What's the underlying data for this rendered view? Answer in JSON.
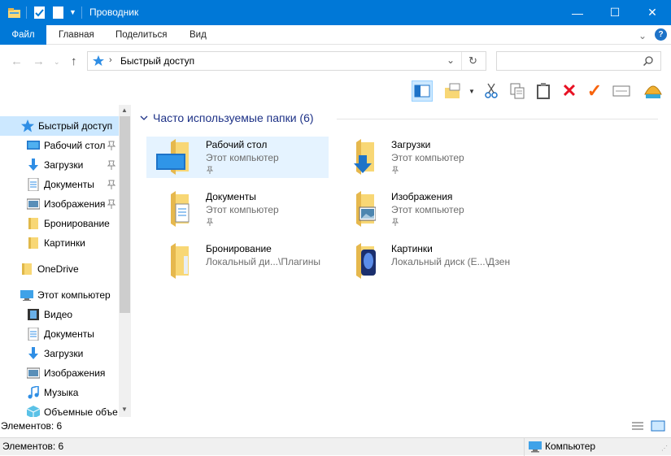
{
  "window": {
    "title": "Проводник",
    "minimize": "—",
    "maximize": "☐",
    "close": "✕"
  },
  "ribbon": {
    "tabs": [
      "Файл",
      "Главная",
      "Поделиться",
      "Вид"
    ],
    "help": "?",
    "expand": "⌄"
  },
  "address": {
    "path": "Быстрый доступ",
    "search_placeholder": ""
  },
  "nav": {
    "items": [
      {
        "label": "Быстрый доступ",
        "icon": "star-icon",
        "pinned": false,
        "selected": true
      },
      {
        "label": "Рабочий стол",
        "icon": "desktop-icon",
        "pinned": true
      },
      {
        "label": "Загрузки",
        "icon": "download-icon",
        "pinned": true
      },
      {
        "label": "Документы",
        "icon": "document-icon",
        "pinned": true
      },
      {
        "label": "Изображения",
        "icon": "pictures-icon",
        "pinned": true
      },
      {
        "label": "Бронирование",
        "icon": "folder-icon",
        "pinned": false
      },
      {
        "label": "Картинки",
        "icon": "folder-icon",
        "pinned": false
      },
      {
        "label": "OneDrive",
        "icon": "folder-icon",
        "pinned": false
      },
      {
        "label": "Этот компьютер",
        "icon": "computer-icon",
        "pinned": false
      },
      {
        "label": "Видео",
        "icon": "video-icon",
        "pinned": false
      },
      {
        "label": "Документы",
        "icon": "document-icon",
        "pinned": false
      },
      {
        "label": "Загрузки",
        "icon": "download-icon",
        "pinned": false
      },
      {
        "label": "Изображения",
        "icon": "pictures-icon",
        "pinned": false
      },
      {
        "label": "Музыка",
        "icon": "music-icon",
        "pinned": false
      },
      {
        "label": "Объемные объе",
        "icon": "3d-objects-icon",
        "pinned": false
      }
    ]
  },
  "content": {
    "group_title": "Часто используемые папки (6)",
    "tiles": [
      {
        "name": "Рабочий стол",
        "location": "Этот компьютер",
        "pinned": true,
        "icon": "desktop-folder-icon"
      },
      {
        "name": "Загрузки",
        "location": "Этот компьютер",
        "pinned": true,
        "icon": "downloads-folder-icon"
      },
      {
        "name": "Документы",
        "location": "Этот компьютер",
        "pinned": true,
        "icon": "documents-folder-icon"
      },
      {
        "name": "Изображения",
        "location": "Этот компьютер",
        "pinned": true,
        "icon": "pictures-folder-icon"
      },
      {
        "name": "Бронирование",
        "location": "Локальный ди...\\Плагины",
        "pinned": false,
        "icon": "folder-icon"
      },
      {
        "name": "Картинки",
        "location": "Локальный диск (E...\\Дзен",
        "pinned": false,
        "icon": "media-folder-icon"
      }
    ]
  },
  "status": {
    "inner": "Элементов: 6",
    "outer": "Элементов: 6",
    "computer": "Компьютер"
  },
  "colors": {
    "accent": "#0078d7",
    "selection": "#cce8ff",
    "folder": "#f8d775",
    "group_title": "#1e3287"
  }
}
